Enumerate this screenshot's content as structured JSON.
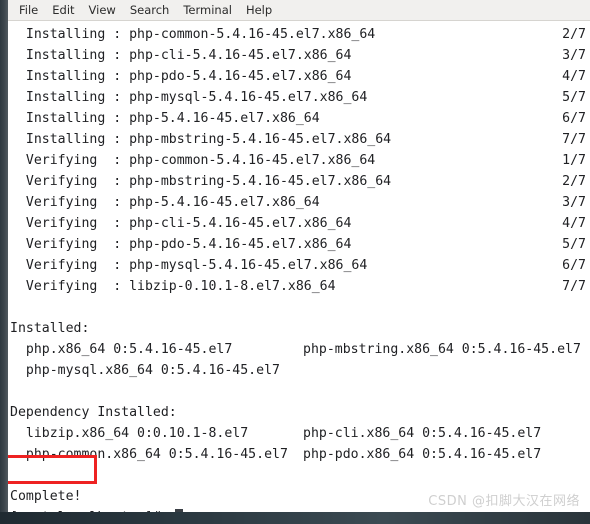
{
  "window": {
    "title": "Terminal",
    "menu": [
      "File",
      "Edit",
      "View",
      "Search",
      "Terminal",
      "Help"
    ]
  },
  "colors": {
    "terminal_background": "#ffffff",
    "terminal_text": "#202124",
    "menubar_background": "#f1f0ee",
    "annotation_box": "#ee2222",
    "window_edge": "#3d464d",
    "cursor": "#3a3f45",
    "watermark": "#cfcfcf"
  },
  "terminal": {
    "lines": [
      {
        "type": "progress",
        "text": "  Installing : php-common-5.4.16-45.el7.x86_64",
        "counter": "2/7"
      },
      {
        "type": "progress",
        "text": "  Installing : php-cli-5.4.16-45.el7.x86_64",
        "counter": "3/7"
      },
      {
        "type": "progress",
        "text": "  Installing : php-pdo-5.4.16-45.el7.x86_64",
        "counter": "4/7"
      },
      {
        "type": "progress",
        "text": "  Installing : php-mysql-5.4.16-45.el7.x86_64",
        "counter": "5/7"
      },
      {
        "type": "progress",
        "text": "  Installing : php-5.4.16-45.el7.x86_64",
        "counter": "6/7"
      },
      {
        "type": "progress",
        "text": "  Installing : php-mbstring-5.4.16-45.el7.x86_64",
        "counter": "7/7"
      },
      {
        "type": "progress",
        "text": "  Verifying  : php-common-5.4.16-45.el7.x86_64",
        "counter": "1/7"
      },
      {
        "type": "progress",
        "text": "  Verifying  : php-mbstring-5.4.16-45.el7.x86_64",
        "counter": "2/7"
      },
      {
        "type": "progress",
        "text": "  Verifying  : php-5.4.16-45.el7.x86_64",
        "counter": "3/7"
      },
      {
        "type": "progress",
        "text": "  Verifying  : php-cli-5.4.16-45.el7.x86_64",
        "counter": "4/7"
      },
      {
        "type": "progress",
        "text": "  Verifying  : php-pdo-5.4.16-45.el7.x86_64",
        "counter": "5/7"
      },
      {
        "type": "progress",
        "text": "  Verifying  : php-mysql-5.4.16-45.el7.x86_64",
        "counter": "6/7"
      },
      {
        "type": "progress",
        "text": "  Verifying  : libzip-0.10.1-8.el7.x86_64",
        "counter": "7/7"
      },
      {
        "type": "blank",
        "text": " "
      },
      {
        "type": "plain",
        "text": "Installed:"
      },
      {
        "type": "columns",
        "text": "  php.x86_64 0:5.4.16-45.el7",
        "col2": "php-mbstring.x86_64 0:5.4.16-45.el7"
      },
      {
        "type": "plain",
        "text": "  php-mysql.x86_64 0:5.4.16-45.el7"
      },
      {
        "type": "blank",
        "text": " "
      },
      {
        "type": "plain",
        "text": "Dependency Installed:"
      },
      {
        "type": "columns",
        "text": "  libzip.x86_64 0:0.10.1-8.el7",
        "col2": "php-cli.x86_64 0:5.4.16-45.el7"
      },
      {
        "type": "columns",
        "text": "  php-common.x86_64 0:5.4.16-45.el7",
        "col2": "php-pdo.x86_64 0:5.4.16-45.el7"
      },
      {
        "type": "blank",
        "text": " "
      },
      {
        "type": "plain",
        "text": "Complete!"
      },
      {
        "type": "prompt",
        "text": "[root@localhost ~]# "
      }
    ]
  },
  "annotation": {
    "highlighted_text": "Complete!"
  },
  "watermark": {
    "text": "CSDN @扣脚大汉在网络"
  }
}
